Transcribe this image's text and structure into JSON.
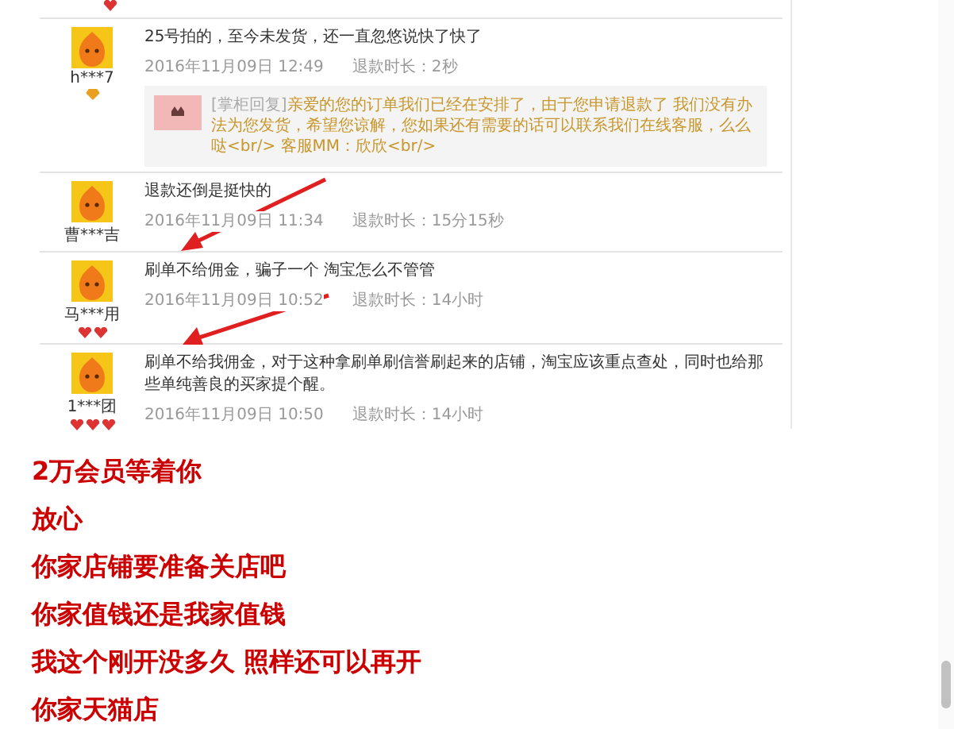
{
  "reviews": [
    {
      "user": "h***7",
      "badges": [
        {
          "kind": "diamond"
        }
      ],
      "text": "25号拍的，至今未发货，还一直忽悠说快了快了",
      "date": "2016年11月09日 12:49",
      "duration": "退款时长：2秒",
      "reply": {
        "label": "[掌柜回复]",
        "text": "亲爱的您的订单我们已经在安排了，由于您申请退款了 我们没有办法为您发货，希望您谅解，您如果还有需要的话可以联系我们在线客服，么么哒<br/> 客服MM：欣欣<br/>"
      }
    },
    {
      "user": "曹***吉",
      "text": "退款还倒是挺快的",
      "date": "2016年11月09日 11:34",
      "duration": "退款时长：15分15秒"
    },
    {
      "user": "马***用",
      "badges": [
        {
          "kind": "heart"
        },
        {
          "kind": "heart"
        }
      ],
      "text": "刷单不给佣金，骗子一个 淘宝怎么不管管",
      "date": "2016年11月09日 10:52",
      "duration": "退款时长：14小时"
    },
    {
      "user": "1***团",
      "badges": [
        {
          "kind": "heart"
        },
        {
          "kind": "heart"
        },
        {
          "kind": "heart"
        }
      ],
      "text": "刷单不给我佣金，对于这种拿刷单刷信誉刷起来的店铺，淘宝应该重点查处，同时也给那些单纯善良的买家提个醒。",
      "date": "2016年11月09日 10:50",
      "duration": "退款时长：14小时"
    }
  ],
  "comments": [
    "2万会员等着你",
    "放心",
    "你家店铺要准备关店吧",
    "你家值钱还是我家值钱",
    "我这个刚开没多久 照样还可以再开",
    "你家天猫店"
  ]
}
